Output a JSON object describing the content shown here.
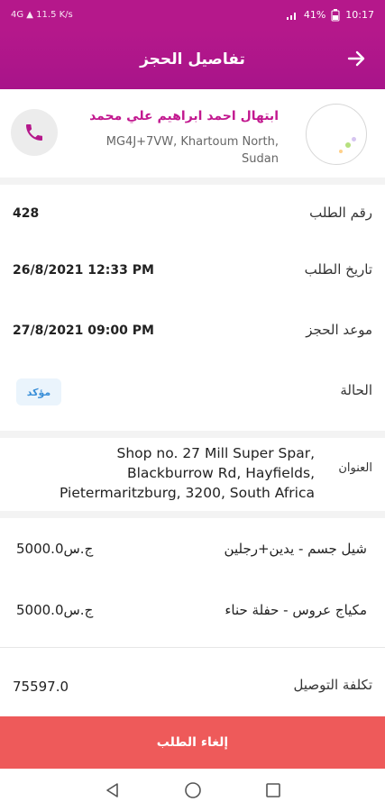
{
  "status_bar": {
    "left_info": "4G ▲ 11.5 K/s",
    "battery": "41%",
    "time": "10:17"
  },
  "app_bar": {
    "title": "تفاصيل الحجز",
    "back_icon": "arrow-right-icon"
  },
  "customer": {
    "name": "ابتهال احمد ابراهيم علي محمد",
    "address_line1": "MG4J+7VW, Khartoum North,",
    "address_line2": "Sudan",
    "call_icon": "phone-icon"
  },
  "details": {
    "order_number_label": "رقم الطلب",
    "order_number": "428",
    "order_date_label": "تاريخ الطلب",
    "order_date": "26/8/2021 12:33 PM",
    "booking_time_label": "موعد الحجز",
    "booking_time": "27/8/2021 09:00 PM",
    "status_label": "الحالة",
    "status": "مؤكد"
  },
  "address": {
    "label": "العنوان",
    "line1": "Shop no. 27 Mill Super Spar,",
    "line2": "Blackburrow Rd, Hayfields,",
    "line3": "Pietermaritzburg, 3200, South Africa"
  },
  "services": [
    {
      "name": "شيل جسم - يدين+رجلين",
      "price": "5000.0ج.س"
    },
    {
      "name": "مكياج عروس - حفلة حناء",
      "price": "5000.0ج.س"
    }
  ],
  "delivery": {
    "label": "تكلفة التوصيل",
    "value": "75597.0"
  },
  "actions": {
    "cancel_label": "إلغاء الطلب"
  },
  "colors": {
    "primary": "#b5188b",
    "accent_name": "#c2188f",
    "cancel": "#ee5a5a",
    "badge_text": "#3a8fd8"
  }
}
